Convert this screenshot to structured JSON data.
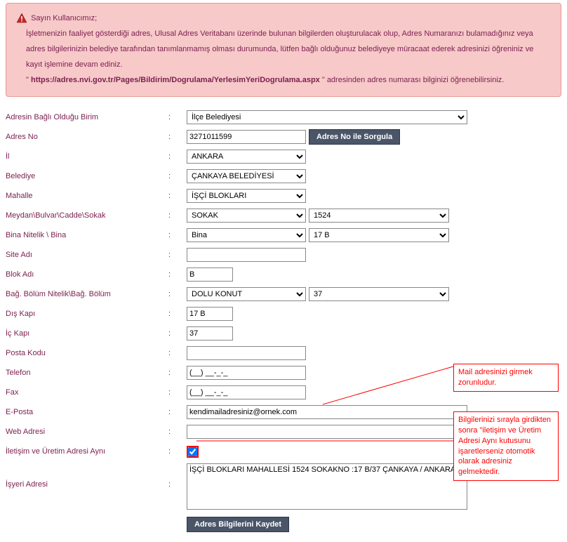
{
  "warning": {
    "title": "Sayın Kullanıcımız;",
    "line1": "İşletmenizin faaliyet gösterdiği adres, Ulusal Adres Veritabanı üzerinde bulunan bilgilerden oluşturulacak olup, Adres Numaranızı bulamadığınız veya adres bilgilerinizin belediye tarafından tanımlanmamış olması durumunda, lütfen bağlı olduğunuz belediyeye müracaat ederek adresinizi öğreniniz ve kayıt işlemine devam ediniz.",
    "link_prefix": "\" ",
    "link_text": "https://adres.nvi.gov.tr/Pages/Bildirim/Dogrulama/YerlesimYeriDogrulama.aspx",
    "link_suffix": " \" adresinden adres numarası bilginizi öğrenebilirsiniz."
  },
  "labels": {
    "birim": "Adresin Bağlı Olduğu Birim",
    "adresno": "Adres No",
    "il": "İl",
    "belediye": "Belediye",
    "mahalle": "Mahalle",
    "cadde": "Meydan\\Bulvar\\Cadde\\Sokak",
    "bina": "Bina Nitelik \\ Bina",
    "siteadi": "Site Adı",
    "blokadi": "Blok Adı",
    "bagbolum": "Bağ. Bölüm Nitelik\\Bağ. Bölüm",
    "diskapi": "Dış Kapı",
    "ickapi": "İç Kapı",
    "postakodu": "Posta Kodu",
    "telefon": "Telefon",
    "fax": "Fax",
    "eposta": "E-Posta",
    "webadresi": "Web Adresi",
    "iletisim": "İletişim ve Üretim Adresi Aynı",
    "isyeri": "İşyeri Adresi"
  },
  "values": {
    "birim": "İlçe Belediyesi",
    "adresno": "3271011599",
    "il": "ANKARA",
    "belediye": "ÇANKAYA BELEDİYESİ",
    "mahalle": "İŞÇİ BLOKLARI",
    "cadde_tip": "SOKAK",
    "cadde_no": "1524",
    "bina_tip": "Bina",
    "bina_no": "17 B",
    "siteadi": "",
    "blokadi": "B",
    "bagbolum_tip": "DOLU KONUT",
    "bagbolum_no": "37",
    "diskapi": "17 B",
    "ickapi": "37",
    "postakodu": "",
    "telefon": "(__) __-_-_",
    "fax": "(__) __-_-_",
    "eposta": "kendimailadresiniz@ornek.com",
    "webadresi": "",
    "isyeri": "İŞÇİ BLOKLARI MAHALLESİ 1524 SOKAKNO :17 B/37 ÇANKAYA / ANKARA"
  },
  "buttons": {
    "sorgula": "Adres No ile Sorgula",
    "kaydet": "Adres Bilgilerini Kaydet"
  },
  "annotations": {
    "mail": "Mail adresinizi girmek zorunludur.",
    "iletisim": "Bilgilerinizi sırayla girdikten sonra \"iletişim ve Üretim Adresi Aynı kutusunu işaretlerseniz otomotik olarak adresiniz gelmektedir."
  }
}
